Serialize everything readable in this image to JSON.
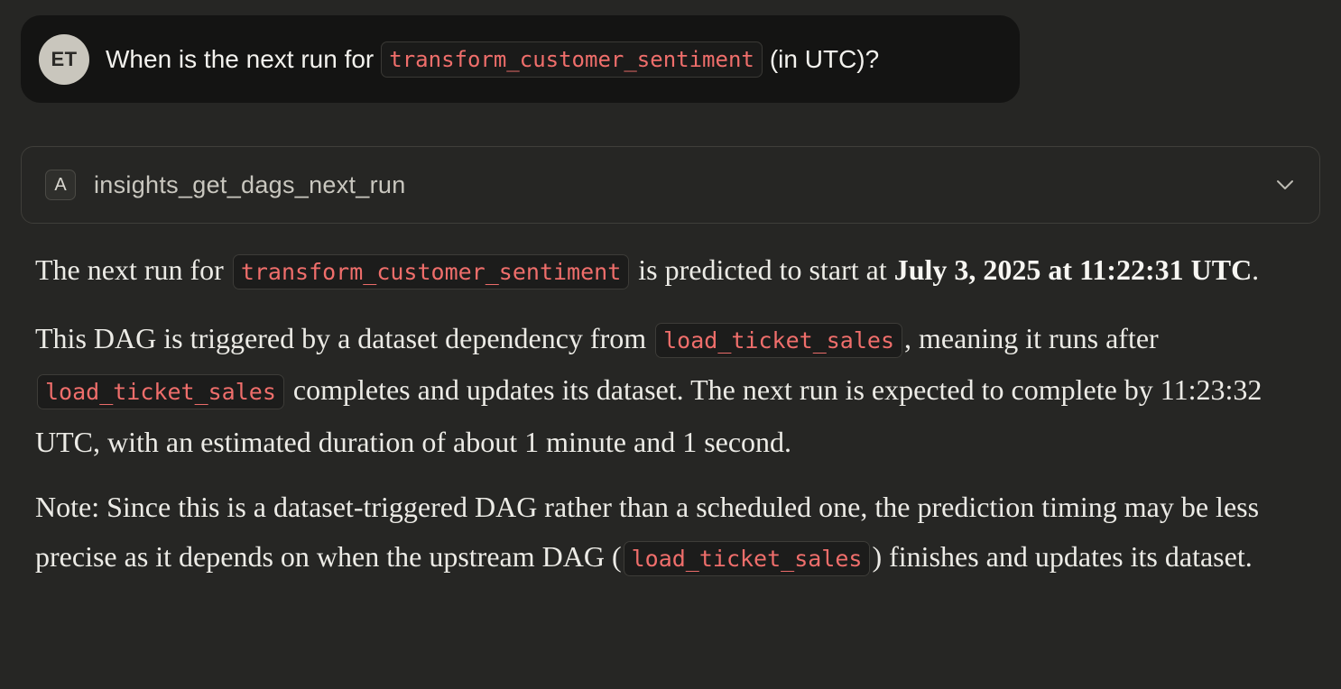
{
  "user_message": {
    "avatar_initials": "ET",
    "text_before": "When is the next run for",
    "code": "transform_customer_sentiment",
    "text_after": "(in UTC)?"
  },
  "tool_call": {
    "badge": "A",
    "name": "insights_get_dags_next_run",
    "toggle_icon": "chevron-down-icon"
  },
  "response": {
    "p1": {
      "t1": "The next run for ",
      "code1": "transform_customer_sentiment",
      "t2": " is predicted to start at ",
      "bold": "July 3, 2025 at 11:22:31 UTC",
      "t3": "."
    },
    "p2": {
      "t1": "This DAG is triggered by a dataset dependency from ",
      "code1": "load_ticket_sales",
      "t2": ", meaning it runs after ",
      "code2": "load_ticket_sales",
      "t3": " completes and updates its dataset. The next run is expected to complete by 11:23:32 UTC, with an estimated duration of about 1 minute and 1 second."
    },
    "p3": {
      "t1": "Note: Since this is a dataset-triggered DAG rather than a scheduled one, the prediction timing may be less precise as it depends on when the upstream DAG (",
      "code1": "load_ticket_sales",
      "t2": ") finishes and updates its dataset."
    }
  },
  "colors": {
    "background": "#262624",
    "user_bubble": "#141413",
    "avatar": "#c9c6bd",
    "code_text": "#ef6e6b"
  }
}
